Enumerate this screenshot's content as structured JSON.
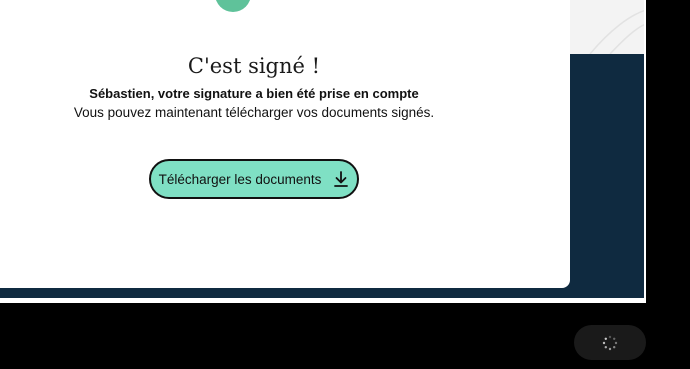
{
  "modal": {
    "title": "C'est signé !",
    "subtitle": "Sébastien, votre signature a bien été prise en compte",
    "body": "Vous pouvez maintenant télécharger vos documents signés.",
    "download_button_label": "Télécharger les documents",
    "icons": {
      "status": "check-icon",
      "download": "download-icon"
    }
  },
  "loader": {
    "icon": "spinner-icon"
  },
  "colors": {
    "background": "#0f2a40",
    "success": "#5fc29a",
    "button_fill": "#7fe0c4",
    "button_border": "#111111"
  }
}
